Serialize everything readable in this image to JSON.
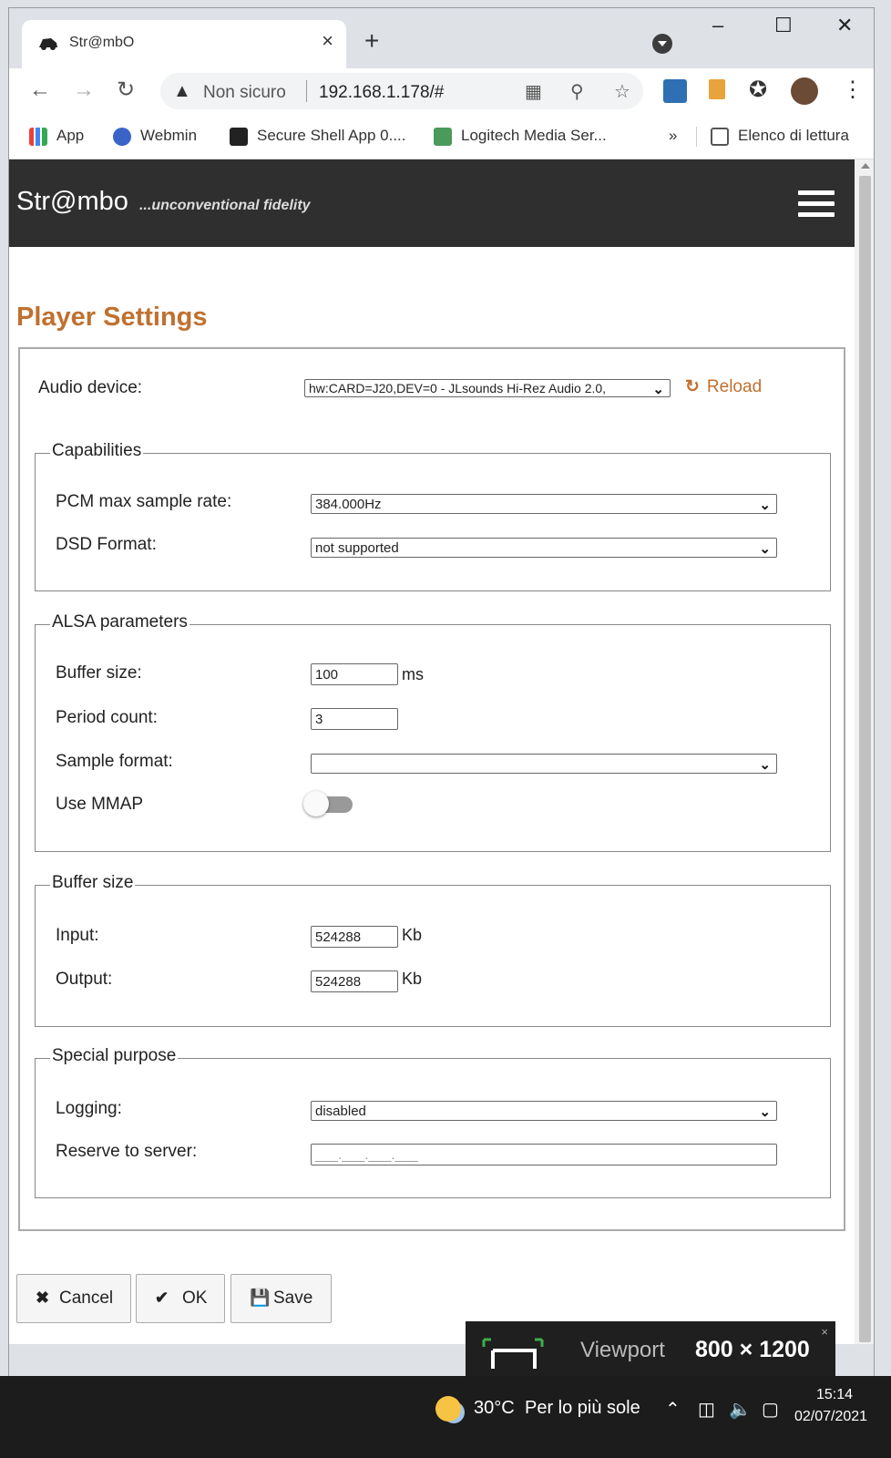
{
  "browser": {
    "tab_title": "Str@mbO",
    "tab_close": "×",
    "new_tab": "+",
    "window_controls": {
      "minimize": "–",
      "maximize": "☐",
      "close": "✕"
    },
    "not_secure_label": "Non sicuro",
    "url": "192.168.1.178/#",
    "bookmarks": [
      {
        "label": "App",
        "icon": "apps-grid-icon"
      },
      {
        "label": "Webmin",
        "icon": "webmin-icon"
      },
      {
        "label": "Secure Shell App 0....",
        "icon": "terminal-icon"
      },
      {
        "label": "Logitech Media Ser...",
        "icon": "media-server-icon"
      }
    ],
    "more_bookmarks": "»",
    "reading_list": "Elenco di lettura"
  },
  "header": {
    "brand": "Str@mbo",
    "tagline": "...unconventional fidelity"
  },
  "page": {
    "title": "Player Settings",
    "audio_device_label": "Audio device:",
    "audio_device_value": "hw:CARD=J20,DEV=0 - JLsounds Hi-Rez Audio 2.0,",
    "reload_label": "Reload",
    "capabilities": {
      "legend": "Capabilities",
      "pcm_label": "PCM max sample rate:",
      "pcm_value": "384.000Hz",
      "dsd_label": "DSD Format:",
      "dsd_value": "not supported"
    },
    "alsa": {
      "legend": "ALSA parameters",
      "buffer_label": "Buffer size:",
      "buffer_value": "100",
      "buffer_unit": "ms",
      "period_label": "Period count:",
      "period_value": "3",
      "sample_format_label": "Sample format:",
      "sample_format_value": "",
      "mmap_label": "Use MMAP",
      "mmap_enabled": false
    },
    "buffer": {
      "legend": "Buffer size",
      "input_label": "Input:",
      "input_value": "524288",
      "input_unit": "Kb",
      "output_label": "Output:",
      "output_value": "524288",
      "output_unit": "Kb"
    },
    "special": {
      "legend": "Special purpose",
      "logging_label": "Logging:",
      "logging_value": "disabled",
      "reserve_label": "Reserve to server:",
      "reserve_value": "___.___.___.___"
    },
    "buttons": {
      "cancel": "Cancel",
      "ok": "OK",
      "save": "Save"
    }
  },
  "viewport_overlay": {
    "label": "Viewport",
    "size": "800 × 1200",
    "close": "×"
  },
  "taskbar": {
    "temperature": "30°C",
    "weather": "Per lo più sole",
    "time": "15:14",
    "date": "02/07/2021"
  },
  "colors": {
    "accent": "#c0702f",
    "header_bg": "#2f2f2f",
    "taskbar_bg": "#1c1c1c"
  }
}
